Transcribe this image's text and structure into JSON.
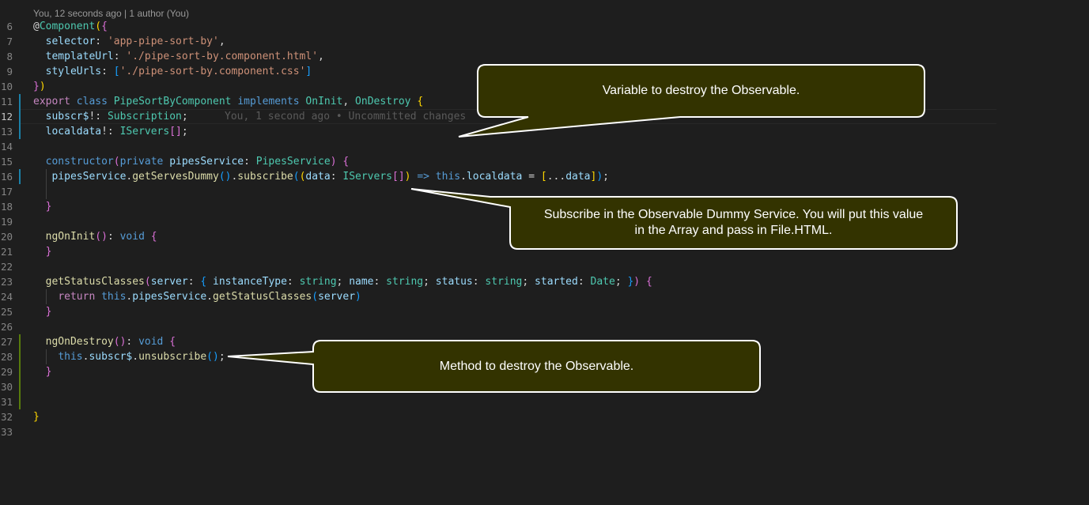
{
  "editor": {
    "codelens": "You, 12 seconds ago | 1 author (You)",
    "line_numbers": [
      "6",
      "7",
      "8",
      "9",
      "10",
      "11",
      "12",
      "13",
      "14",
      "15",
      "16",
      "17",
      "18",
      "19",
      "20",
      "21",
      "22",
      "23",
      "24",
      "25",
      "26",
      "27",
      "28",
      "29",
      "30",
      "31",
      "32",
      "33"
    ],
    "active_line": "12",
    "inline_blame": "You, 1 second ago • Uncommitted changes",
    "lines": [
      [
        {
          "t": "@",
          "c": "punc"
        },
        {
          "t": "Component",
          "c": "type"
        },
        {
          "t": "(",
          "c": "b1"
        },
        {
          "t": "{",
          "c": "b2"
        }
      ],
      [
        {
          "t": "  "
        },
        {
          "t": "selector",
          "c": "prop"
        },
        {
          "t": ": "
        },
        {
          "t": "'app-pipe-sort-by'",
          "c": "str"
        },
        {
          "t": ","
        }
      ],
      [
        {
          "t": "  "
        },
        {
          "t": "templateUrl",
          "c": "prop"
        },
        {
          "t": ": "
        },
        {
          "t": "'./pipe-sort-by.component.html'",
          "c": "str"
        },
        {
          "t": ","
        }
      ],
      [
        {
          "t": "  "
        },
        {
          "t": "styleUrls",
          "c": "prop"
        },
        {
          "t": ": "
        },
        {
          "t": "[",
          "c": "b3"
        },
        {
          "t": "'./pipe-sort-by.component.css'",
          "c": "str"
        },
        {
          "t": "]",
          "c": "b3"
        }
      ],
      [
        {
          "t": "}",
          "c": "b2"
        },
        {
          "t": ")",
          "c": "b1"
        }
      ],
      [
        {
          "t": "export",
          "c": "ctl"
        },
        {
          "t": " "
        },
        {
          "t": "class",
          "c": "kw"
        },
        {
          "t": " "
        },
        {
          "t": "PipeSortByComponent",
          "c": "type"
        },
        {
          "t": " "
        },
        {
          "t": "implements",
          "c": "kw"
        },
        {
          "t": " "
        },
        {
          "t": "OnInit",
          "c": "type"
        },
        {
          "t": ", "
        },
        {
          "t": "OnDestroy",
          "c": "type"
        },
        {
          "t": " "
        },
        {
          "t": "{",
          "c": "b1"
        }
      ],
      [
        {
          "t": "  "
        },
        {
          "t": "subscr$",
          "c": "prop"
        },
        {
          "t": "!: "
        },
        {
          "t": "Subscription",
          "c": "type"
        },
        {
          "t": ";"
        }
      ],
      [
        {
          "t": "  "
        },
        {
          "t": "localdata",
          "c": "prop"
        },
        {
          "t": "!: "
        },
        {
          "t": "IServers",
          "c": "type"
        },
        {
          "t": "[]",
          "c": "b2"
        },
        {
          "t": ";"
        }
      ],
      [],
      [
        {
          "t": "  "
        },
        {
          "t": "constructor",
          "c": "kw"
        },
        {
          "t": "(",
          "c": "b2"
        },
        {
          "t": "private",
          "c": "kw"
        },
        {
          "t": " "
        },
        {
          "t": "pipesService",
          "c": "prop"
        },
        {
          "t": ": "
        },
        {
          "t": "PipesService",
          "c": "type"
        },
        {
          "t": ")",
          "c": "b2"
        },
        {
          "t": " "
        },
        {
          "t": "{",
          "c": "b2"
        }
      ],
      [
        {
          "t": "   "
        },
        {
          "t": "pipesService",
          "c": "prop"
        },
        {
          "t": "."
        },
        {
          "t": "getServesDummy",
          "c": "fn"
        },
        {
          "t": "()",
          "c": "b3"
        },
        {
          "t": "."
        },
        {
          "t": "subscribe",
          "c": "fn"
        },
        {
          "t": "(",
          "c": "b3"
        },
        {
          "t": "(",
          "c": "b1"
        },
        {
          "t": "data",
          "c": "prop"
        },
        {
          "t": ": "
        },
        {
          "t": "IServers",
          "c": "type"
        },
        {
          "t": "[]",
          "c": "b2"
        },
        {
          "t": ")",
          "c": "b1"
        },
        {
          "t": " "
        },
        {
          "t": "=>",
          "c": "kw"
        },
        {
          "t": " "
        },
        {
          "t": "this",
          "c": "kw"
        },
        {
          "t": "."
        },
        {
          "t": "localdata",
          "c": "prop"
        },
        {
          "t": " = "
        },
        {
          "t": "[",
          "c": "b1"
        },
        {
          "t": "..."
        },
        {
          "t": "data",
          "c": "prop"
        },
        {
          "t": "]",
          "c": "b1"
        },
        {
          "t": ")",
          "c": "b3"
        },
        {
          "t": ";"
        }
      ],
      [],
      [
        {
          "t": "  "
        },
        {
          "t": "}",
          "c": "b2"
        }
      ],
      [],
      [
        {
          "t": "  "
        },
        {
          "t": "ngOnInit",
          "c": "fn"
        },
        {
          "t": "()",
          "c": "b2"
        },
        {
          "t": ": "
        },
        {
          "t": "void",
          "c": "kw"
        },
        {
          "t": " "
        },
        {
          "t": "{",
          "c": "b2"
        }
      ],
      [
        {
          "t": "  "
        },
        {
          "t": "}",
          "c": "b2"
        }
      ],
      [],
      [
        {
          "t": "  "
        },
        {
          "t": "getStatusClasses",
          "c": "fn"
        },
        {
          "t": "(",
          "c": "b2"
        },
        {
          "t": "server",
          "c": "prop"
        },
        {
          "t": ": "
        },
        {
          "t": "{",
          "c": "b3"
        },
        {
          "t": " "
        },
        {
          "t": "instanceType",
          "c": "prop"
        },
        {
          "t": ": "
        },
        {
          "t": "string",
          "c": "type"
        },
        {
          "t": "; "
        },
        {
          "t": "name",
          "c": "prop"
        },
        {
          "t": ": "
        },
        {
          "t": "string",
          "c": "type"
        },
        {
          "t": "; "
        },
        {
          "t": "status",
          "c": "prop"
        },
        {
          "t": ": "
        },
        {
          "t": "string",
          "c": "type"
        },
        {
          "t": "; "
        },
        {
          "t": "started",
          "c": "prop"
        },
        {
          "t": ": "
        },
        {
          "t": "Date",
          "c": "type"
        },
        {
          "t": "; "
        },
        {
          "t": "}",
          "c": "b3"
        },
        {
          "t": ")",
          "c": "b2"
        },
        {
          "t": " "
        },
        {
          "t": "{",
          "c": "b2"
        }
      ],
      [
        {
          "t": "    "
        },
        {
          "t": "return",
          "c": "ctl"
        },
        {
          "t": " "
        },
        {
          "t": "this",
          "c": "kw"
        },
        {
          "t": "."
        },
        {
          "t": "pipesService",
          "c": "prop"
        },
        {
          "t": "."
        },
        {
          "t": "getStatusClasses",
          "c": "fn"
        },
        {
          "t": "(",
          "c": "b3"
        },
        {
          "t": "server",
          "c": "prop"
        },
        {
          "t": ")",
          "c": "b3"
        }
      ],
      [
        {
          "t": "  "
        },
        {
          "t": "}",
          "c": "b2"
        }
      ],
      [],
      [
        {
          "t": "  "
        },
        {
          "t": "ngOnDestroy",
          "c": "fn"
        },
        {
          "t": "()",
          "c": "b2"
        },
        {
          "t": ": "
        },
        {
          "t": "void",
          "c": "kw"
        },
        {
          "t": " "
        },
        {
          "t": "{",
          "c": "b2"
        }
      ],
      [
        {
          "t": "    "
        },
        {
          "t": "this",
          "c": "kw"
        },
        {
          "t": "."
        },
        {
          "t": "subscr$",
          "c": "prop"
        },
        {
          "t": "."
        },
        {
          "t": "unsubscribe",
          "c": "fn"
        },
        {
          "t": "()",
          "c": "b3"
        },
        {
          "t": ";"
        }
      ],
      [
        {
          "t": "  "
        },
        {
          "t": "}",
          "c": "b2"
        }
      ],
      [],
      [],
      [
        {
          "t": "}",
          "c": "b1"
        }
      ],
      []
    ]
  },
  "callouts": {
    "variable": "Variable to destroy the Observable.",
    "subscribe_line1": "Subscribe in the Observable Dummy Service. You will put this value",
    "subscribe_line2": "in the Array and pass in File.HTML.",
    "method": "Method to destroy the Observable."
  },
  "colors": {
    "background": "#1e1e1e",
    "callout_fill": "#333300",
    "callout_border": "#ffffff",
    "callout_text": "#ffffff",
    "git_modified_bar": "#1b81a8",
    "git_added_bar": "#587c0c"
  }
}
